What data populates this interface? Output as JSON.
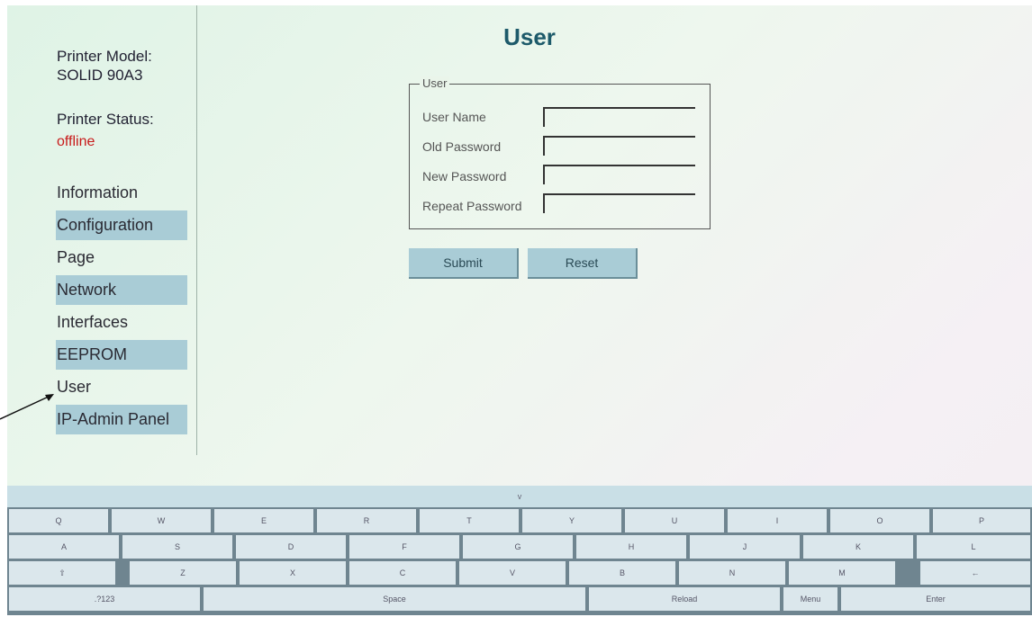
{
  "sidebar": {
    "model_label": "Printer Model:",
    "model_value": "SOLID 90A3",
    "status_label": "Printer Status:",
    "status_value": "offline",
    "nav": [
      {
        "label": "Information"
      },
      {
        "label": "Configuration"
      },
      {
        "label": "Page"
      },
      {
        "label": "Network"
      },
      {
        "label": "Interfaces"
      },
      {
        "label": "EEPROM"
      },
      {
        "label": "User"
      },
      {
        "label": "IP-Admin Panel"
      }
    ]
  },
  "main": {
    "title": "User",
    "fieldset_legend": "User",
    "fields": [
      {
        "label": "User Name",
        "value": ""
      },
      {
        "label": "Old Password",
        "value": ""
      },
      {
        "label": "New Password",
        "value": ""
      },
      {
        "label": "Repeat Password",
        "value": ""
      }
    ],
    "submit_label": "Submit",
    "reset_label": "Reset"
  },
  "keyboard": {
    "collapse_label": "v",
    "row1": [
      "Q",
      "W",
      "E",
      "R",
      "T",
      "Y",
      "U",
      "I",
      "O",
      "P"
    ],
    "row2": [
      "A",
      "S",
      "D",
      "F",
      "G",
      "H",
      "J",
      "K",
      "L"
    ],
    "row3": [
      "⇧",
      "Z",
      "X",
      "C",
      "V",
      "B",
      "N",
      "M",
      "←"
    ],
    "row4": [
      ".?123",
      "Space",
      "Reload",
      "Menu",
      "Enter"
    ]
  },
  "colors": {
    "accent": "#a9ccd6",
    "status_offline": "#c81a1a",
    "title": "#1d5a6a"
  }
}
